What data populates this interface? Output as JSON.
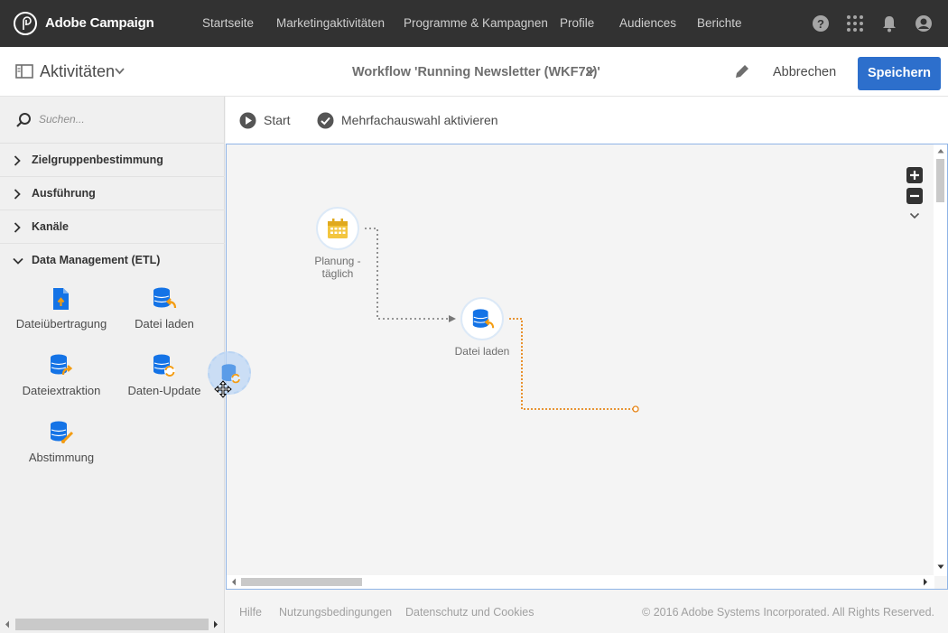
{
  "app": {
    "name": "Adobe Campaign"
  },
  "nav": [
    "Startseite",
    "Marketingaktivitäten",
    "Programme & Kampagnen",
    "Profile",
    "Audiences",
    "Berichte"
  ],
  "header": {
    "panel_title": "Aktivitäten",
    "workflow_title": "Workflow 'Running Newsletter (WKF72)'",
    "cancel_label": "Abbrechen",
    "save_label": "Speichern"
  },
  "sidebar": {
    "search_placeholder": "Suchen...",
    "categories": [
      {
        "label": "Zielgruppenbestimmung",
        "expanded": false
      },
      {
        "label": "Ausführung",
        "expanded": false
      },
      {
        "label": "Kanäle",
        "expanded": false
      },
      {
        "label": "Data Management (ETL)",
        "expanded": true
      }
    ],
    "activities": [
      {
        "label": "Dateiübertragung",
        "icon": "file-transfer-icon"
      },
      {
        "label": "Datei laden",
        "icon": "load-file-icon"
      },
      {
        "label": "Dateiextraktion",
        "icon": "extract-file-icon"
      },
      {
        "label": "Daten-Update",
        "icon": "update-data-icon"
      },
      {
        "label": "Abstimmung",
        "icon": "reconciliation-icon"
      }
    ]
  },
  "toolbar": {
    "start_label": "Start",
    "multiselect_label": "Mehrfachauswahl aktivieren"
  },
  "canvas": {
    "nodes": [
      {
        "id": "scheduler",
        "label_line1": "Planung -",
        "label_line2": "täglich",
        "icon": "calendar-icon"
      },
      {
        "id": "load-file",
        "label": "Datei laden",
        "icon": "load-file-icon"
      }
    ]
  },
  "footer": {
    "help": "Hilfe",
    "terms": "Nutzungsbedingungen",
    "privacy": "Datenschutz und Cookies",
    "copyright": "© 2016 Adobe Systems Incorporated. All Rights Reserved."
  },
  "colors": {
    "accent": "#2d6fcc",
    "topbar": "#323232",
    "node_icon": "#1473e6",
    "orange": "#e68619",
    "calendar": "#f3c63f"
  }
}
